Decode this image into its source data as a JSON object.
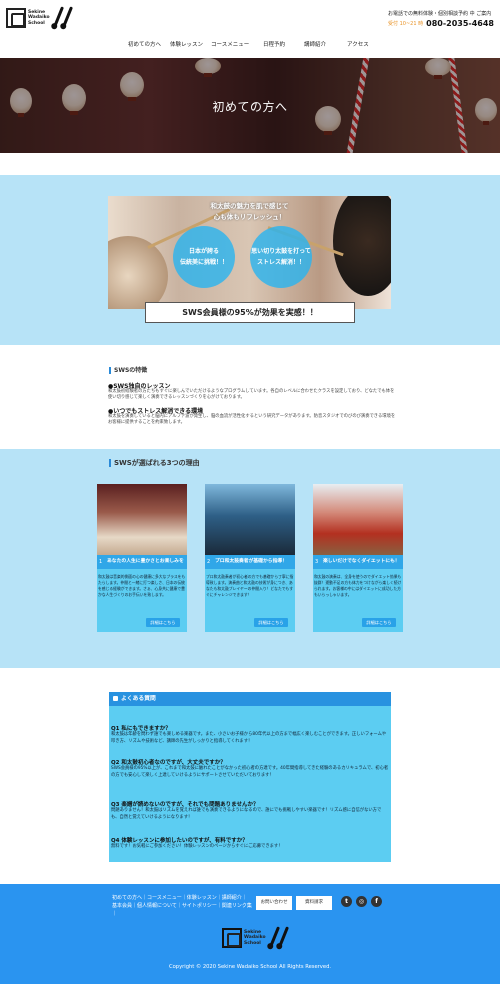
{
  "brand": {
    "line1": "Sekine",
    "line2": "Wadaiko",
    "line3": "School"
  },
  "contact": {
    "note": "お電話での無料体験・個別相談予約 中 ご案内",
    "hours": "受付 10~21 時",
    "tel": "080-2035-4648"
  },
  "nav": {
    "items": [
      "初めての方へ",
      "体験レッスン",
      "コースメニュー",
      "日程予約",
      "講師紹介",
      "アクセス"
    ]
  },
  "hero": {
    "title": "初めての方へ"
  },
  "intro": {
    "overlay_line1": "和太鼓の魅力を肌で感じて",
    "overlay_line2": "心も体もリフレッシュ！",
    "circle1_line1": "日本が誇る",
    "circle1_line2": "伝統美に挑戦！！",
    "circle2_line1": "思い切り太鼓を打って",
    "circle2_line2": "ストレス解消！！",
    "result": "SWS会員様の95%が効果を実感！！"
  },
  "features": {
    "heading": "SWSの特徴",
    "items": [
      {
        "title": "●SWS独自のレッスン",
        "desc": "和太鼓初経験者の方たちもすぐに楽しんでいただけるようなプログラムしています。各自のレベルに合わせたクラスを設定しており、どなたでも体を使い切り感じて楽しく演奏できるレッスンづくりを心がけております。"
      },
      {
        "title": "●いつでもストレス解消できる環境",
        "desc": "和太鼓を演奏していると脳内にアルファ波が発生し、脳の血流が活性化するという研究データがあります。防音スタジオでのびのび演奏できる環境をお客様に提供することを約束致します。"
      }
    ]
  },
  "reasons": {
    "heading": "SWSが選ばれる3つの理由",
    "cards": [
      {
        "num": "1",
        "caption": "あなたの人生に豊かさとお楽しみを",
        "desc": "和太鼓は音楽的側面の心の健康に多大なプラスをもたらします。仲間と一緒に打つ楽しさ、日本の伝統を感じる経験ができます。さぁ、心身共に健康で豊かな人生づくりのお手伝いを致します。",
        "button": "詳細はこちら"
      },
      {
        "num": "2",
        "caption": "プロ和太鼓奏者が基礎から指導！",
        "desc": "プロ和太鼓奏者が初心者の方でも基礎から丁寧に指導致します。演奏曲と和太鼓の技術が身につき、あなたも和太鼓プレイヤーの仲間入り！どなたでもすぐにチャレンジできます！",
        "button": "詳細はこちら"
      },
      {
        "num": "3",
        "caption": "楽しいだけでなくダイエットにも！",
        "desc": "和太鼓の演奏は、全身を使うのでダイエット効果も抜群！運動不足の方も体力をつけながら楽しく続けられます。お客様の中にはダイエットに成功した方もいらっしゃいます。",
        "button": "詳細はこちら"
      }
    ]
  },
  "faq": {
    "heading": "よくある質問",
    "items": [
      {
        "q": "Q1 私にもできますか？",
        "a": "和太鼓は年齢を問わず誰でも楽しめる楽器です。また、小さいお子様から80年代以上の方まで幅広く楽しむことができます。正しいフォームや叩き方、リズムや技術など、講師の先生がしっかりと指導してくれます！"
      },
      {
        "q": "Q2 和太鼓初心者なのですが、大丈夫ですか？",
        "a": "SWS会員様の95%以上が、これまで和太鼓に触れたことがなかった初心者の方達です。40年間指導してきた経験のあるカリキュラムで、初心者の方でも安心して楽しく上達していけるようにサポートさせていただいております！"
      },
      {
        "q": "Q3 楽譜が読めないのですが、それでも問題ありませんか？",
        "a": "問題ありません！和太鼓はリズムを覚えれば誰でも演奏できるようになるので、誰にでも挑戦しやすい楽器です！リズム感に自信がない方でも、自然と覚えていけるようになります！"
      },
      {
        "q": "Q4 体験レッスンに参加したいのですが、有料ですか？",
        "a": "無料です！お気軽にご参加ください！体験レッスンのページからすぐにご応募できます！"
      }
    ]
  },
  "footer": {
    "links_line1": "初めての方へ｜コースメニュー｜体験レッスン｜講師紹介｜",
    "links_line2": "基本会員｜個人情報について｜サイトポリシー｜関連リンク集｜",
    "btn_contact": "お問い合わせ",
    "btn_apply": "資料請求",
    "copyright": "Copyright © 2020 Sekine Wadaiko School All Rights Reserved."
  },
  "colors": {
    "accent": "#2a94f0",
    "light": "#b7e3f7",
    "card": "#5ccdf2",
    "hours": "#e9952b"
  }
}
